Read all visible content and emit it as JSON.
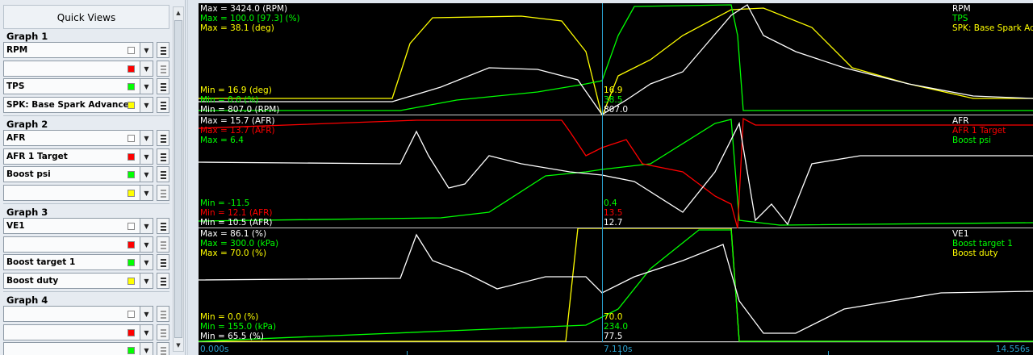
{
  "quick_views": {
    "title": "Quick Views",
    "graphs": [
      {
        "header": "Graph 1",
        "rows": [
          {
            "label": "RPM",
            "color": "#ffffff"
          },
          {
            "label": "",
            "color": "#ff0000"
          },
          {
            "label": "TPS",
            "color": "#00ff00"
          },
          {
            "label": "SPK: Base Spark Advance",
            "color": "#ffff00"
          }
        ]
      },
      {
        "header": "Graph 2",
        "rows": [
          {
            "label": "AFR",
            "color": "#ffffff"
          },
          {
            "label": "AFR 1 Target",
            "color": "#ff0000"
          },
          {
            "label": "Boost psi",
            "color": "#00ff00"
          },
          {
            "label": "",
            "color": "#ffff00"
          }
        ]
      },
      {
        "header": "Graph 3",
        "rows": [
          {
            "label": "VE1",
            "color": "#ffffff"
          },
          {
            "label": "",
            "color": "#ff0000"
          },
          {
            "label": "Boost target 1",
            "color": "#00ff00"
          },
          {
            "label": "Boost duty",
            "color": "#ffff00"
          }
        ]
      },
      {
        "header": "Graph 4",
        "rows": [
          {
            "label": "",
            "color": "#ffffff"
          },
          {
            "label": "",
            "color": "#ff0000"
          },
          {
            "label": "",
            "color": "#00ff00"
          }
        ]
      }
    ]
  },
  "graphs": [
    {
      "max_labels": [
        {
          "text": "Max = 3424.0 (RPM)",
          "color": "#ffffff"
        },
        {
          "text": "Max = 100.0 [97.3] (%)",
          "color": "#00ff00"
        },
        {
          "text": "Max = 38.1 (deg)",
          "color": "#ffff00"
        }
      ],
      "min_labels": [
        {
          "text": "Min = 16.9 (deg)",
          "color": "#ffff00"
        },
        {
          "text": "Min = 0.0 (%)",
          "color": "#00ff00"
        },
        {
          "text": "Min = 807.0 (RPM)",
          "color": "#ffffff"
        }
      ],
      "legend": [
        {
          "text": "RPM",
          "color": "#ffffff"
        },
        {
          "text": "TPS",
          "color": "#00ff00"
        },
        {
          "text": "SPK: Base Spark Advance",
          "color": "#ffff00"
        }
      ],
      "cursor_values": [
        {
          "text": "16.9",
          "color": "#ffff00"
        },
        {
          "text": "38.5",
          "color": "#00ff00"
        },
        {
          "text": "807.0",
          "color": "#ffffff"
        }
      ]
    },
    {
      "max_labels": [
        {
          "text": "Max = 15.7 (AFR)",
          "color": "#ffffff"
        },
        {
          "text": "Max = 13.7 (AFR)",
          "color": "#ff0000"
        },
        {
          "text": "Max = 6.4",
          "color": "#00ff00"
        }
      ],
      "min_labels": [
        {
          "text": "Min = -11.5",
          "color": "#00ff00"
        },
        {
          "text": "Min = 12.1 (AFR)",
          "color": "#ff0000"
        },
        {
          "text": "Min = 10.5 (AFR)",
          "color": "#ffffff"
        }
      ],
      "legend": [
        {
          "text": "AFR",
          "color": "#ffffff"
        },
        {
          "text": "AFR 1 Target",
          "color": "#ff0000"
        },
        {
          "text": "Boost psi",
          "color": "#00ff00"
        }
      ],
      "cursor_values": [
        {
          "text": "0.4",
          "color": "#00ff00"
        },
        {
          "text": "13.5",
          "color": "#ff0000"
        },
        {
          "text": "12.7",
          "color": "#ffffff"
        }
      ]
    },
    {
      "max_labels": [
        {
          "text": "Max = 86.1 (%)",
          "color": "#ffffff"
        },
        {
          "text": "Max = 300.0 (kPa)",
          "color": "#00ff00"
        },
        {
          "text": "Max = 70.0 (%)",
          "color": "#ffff00"
        }
      ],
      "min_labels": [
        {
          "text": "Min = 0.0 (%)",
          "color": "#ffff00"
        },
        {
          "text": "Min = 155.0 (kPa)",
          "color": "#00ff00"
        },
        {
          "text": "Min = 65.5 (%)",
          "color": "#ffffff"
        }
      ],
      "legend": [
        {
          "text": "VE1",
          "color": "#ffffff"
        },
        {
          "text": "Boost target 1",
          "color": "#00ff00"
        },
        {
          "text": "Boost duty",
          "color": "#ffff00"
        }
      ],
      "cursor_values": [
        {
          "text": "70.0",
          "color": "#ffff00"
        },
        {
          "text": "234.0",
          "color": "#00ff00"
        },
        {
          "text": "77.5",
          "color": "#ffffff"
        }
      ]
    }
  ],
  "time_axis": {
    "start": "0.000s",
    "cursor": "7.110s",
    "end": "14.556s"
  }
}
